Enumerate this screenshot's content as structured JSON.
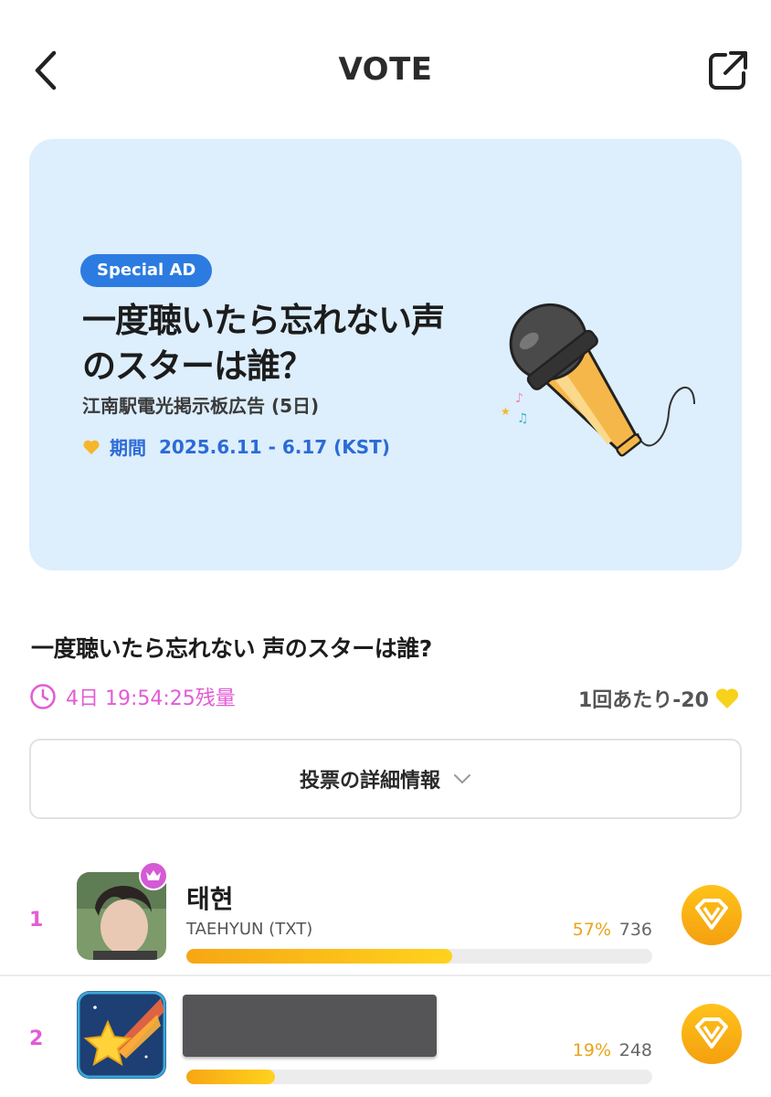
{
  "header": {
    "title": "VOTE",
    "back_icon": "chevron-left-icon",
    "share_icon": "share-external-icon"
  },
  "banner": {
    "badge": "Special AD",
    "title": "一度聴いたら忘れない声のスターは誰？",
    "subtitle": "江南駅電光掲示板広告 (5日)",
    "period_label": "期間",
    "period_dates": "2025.6.11 - 6.17 (KST)",
    "background_color": "#ddeefc",
    "illustration": "microphone-illustration"
  },
  "vote": {
    "title": "一度聴いたら忘れない 声のスターは誰?",
    "timer": "4日 19:54:25残量",
    "cost": "1回あたり-20",
    "detail_button": "投票の詳細情報"
  },
  "candidates": [
    {
      "rank": "1",
      "name": "태현",
      "subname": "TAEHYUN (TXT)",
      "percent": "57%",
      "count": "736",
      "progress": 0.57
    },
    {
      "rank": "2",
      "name": "",
      "subname": "",
      "percent": "19%",
      "count": "248",
      "progress": 0.19
    }
  ],
  "colors": {
    "accent_pink": "#e35bd6",
    "accent_blue": "#2c7be0",
    "gold": "#f4a00f"
  }
}
